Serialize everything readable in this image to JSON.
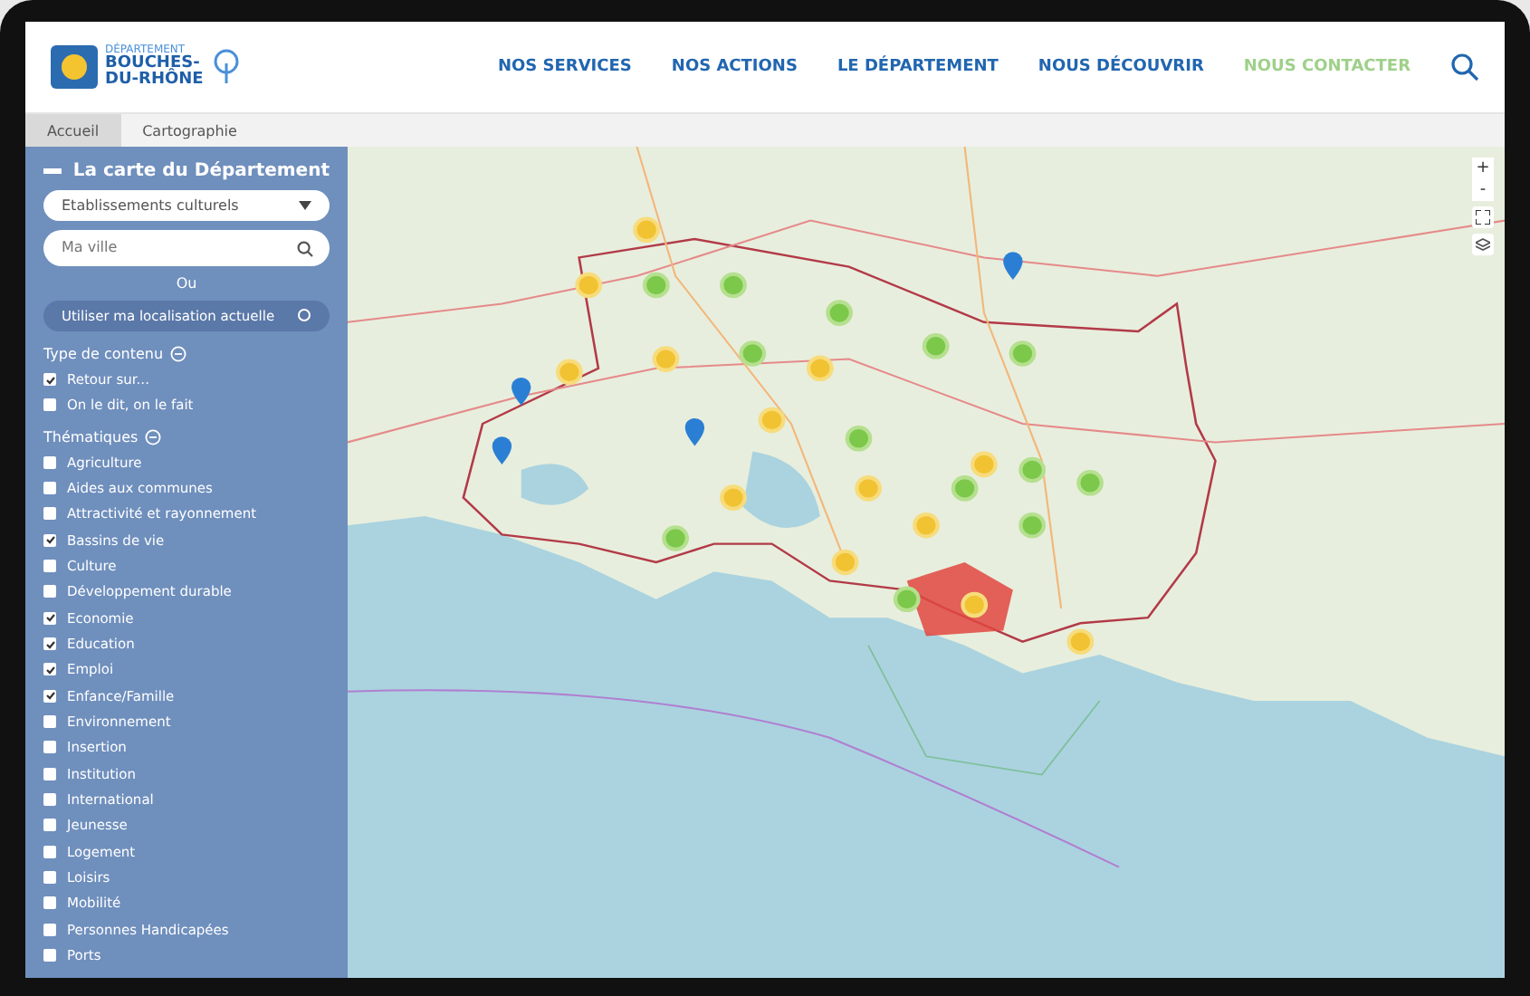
{
  "header": {
    "logo": {
      "line_1": "DÉPARTEMENT",
      "line_2": "BOUCHES-",
      "line_3": "DU-RHÔNE"
    },
    "nav": [
      {
        "label": "NOS SERVICES",
        "highlighted": false
      },
      {
        "label": "NOS ACTIONS",
        "highlighted": false
      },
      {
        "label": "LE DÉPARTEMENT",
        "highlighted": false
      },
      {
        "label": "NOUS DÉCOUVRIR",
        "highlighted": false
      },
      {
        "label": "NOUS CONTACTER",
        "highlighted": true
      }
    ]
  },
  "breadcrumb": [
    {
      "label": "Accueil",
      "selected": true
    },
    {
      "label": "Cartographie",
      "selected": false
    }
  ],
  "sidebar": {
    "title": "La carte du Département",
    "category_select": "Etablissements culturels",
    "city_field": {
      "placeholder": "Ma ville"
    },
    "or_label": "Ou",
    "locate_button": "Utiliser ma localisation actuelle",
    "groups": [
      {
        "title": "Type de contenu",
        "items": [
          {
            "label": "Retour sur...",
            "checked": true
          },
          {
            "label": "On le dit, on le fait",
            "checked": false
          }
        ]
      },
      {
        "title": "Thématiques",
        "items": [
          {
            "label": "Agriculture",
            "checked": false
          },
          {
            "label": "Aides aux communes",
            "checked": false
          },
          {
            "label": "Attractivité et rayonnement",
            "checked": false
          },
          {
            "label": "Bassins de vie",
            "checked": true
          },
          {
            "label": "Culture",
            "checked": false
          },
          {
            "label": "Développement durable",
            "checked": false
          },
          {
            "label": "Economie",
            "checked": true
          },
          {
            "label": "Education",
            "checked": true
          },
          {
            "label": "Emploi",
            "checked": true
          },
          {
            "label": "Enfance/Famille",
            "checked": true
          },
          {
            "label": "Environnement",
            "checked": false
          },
          {
            "label": "Insertion",
            "checked": false
          },
          {
            "label": "Institution",
            "checked": false
          },
          {
            "label": "International",
            "checked": false
          },
          {
            "label": "Jeunesse",
            "checked": false
          },
          {
            "label": "Logement",
            "checked": false
          },
          {
            "label": "Loisirs",
            "checked": false
          },
          {
            "label": "Mobilité",
            "checked": false
          },
          {
            "label": "Personnes Handicapées",
            "checked": false
          },
          {
            "label": "Ports",
            "checked": false
          }
        ]
      }
    ]
  },
  "map": {
    "zoom_in": "+",
    "zoom_out": "-"
  }
}
